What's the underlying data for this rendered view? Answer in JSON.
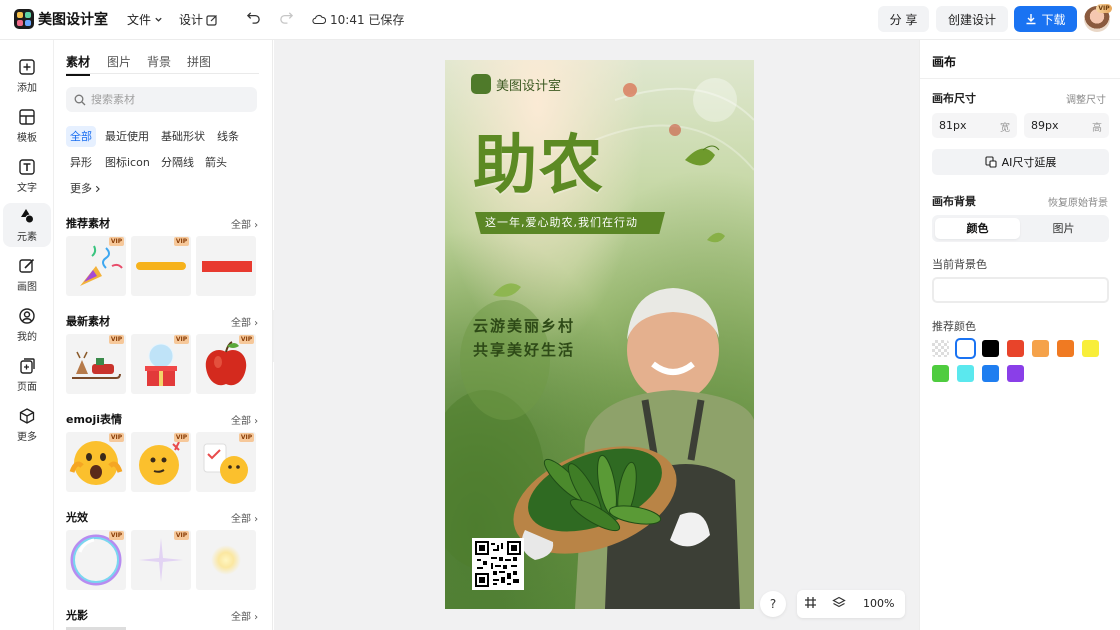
{
  "app": {
    "name": "美图设计室"
  },
  "topbar": {
    "file_menu": "文件",
    "design_menu": "设计",
    "save_status": "10:41 已保存",
    "share_label": "分 享",
    "create_label": "创建设计",
    "download_label": "下载",
    "avatar_badge": "VIP"
  },
  "rail": {
    "items": [
      {
        "label": "添加",
        "icon": "plus-square-icon"
      },
      {
        "label": "模板",
        "icon": "template-icon"
      },
      {
        "label": "文字",
        "icon": "text-icon"
      },
      {
        "label": "元素",
        "icon": "shapes-icon"
      },
      {
        "label": "画图",
        "icon": "draw-icon"
      },
      {
        "label": "我的",
        "icon": "user-icon"
      },
      {
        "label": "页面",
        "icon": "pages-icon"
      },
      {
        "label": "更多",
        "icon": "cube-icon"
      }
    ]
  },
  "panel": {
    "tabs": [
      "素材",
      "图片",
      "背景",
      "拼图"
    ],
    "search_placeholder": "搜索素材",
    "chips": [
      "全部",
      "最近使用",
      "基础形状",
      "线条",
      "异形",
      "图标icon",
      "分隔线",
      "箭头",
      "更多"
    ],
    "more_link": "全部",
    "vip_badge": "VIP",
    "sections": [
      {
        "title": "推荐素材"
      },
      {
        "title": "最新素材"
      },
      {
        "title": "emoji表情"
      },
      {
        "title": "光效"
      },
      {
        "title": "光影"
      }
    ]
  },
  "poster": {
    "brand": "美图设计室",
    "title": "助农",
    "banner": "这一年,爱心助农,我们在行动",
    "slogan_line1": "云游美丽乡村",
    "slogan_line2": "共享美好生活"
  },
  "bottom_tools": {
    "help": "?",
    "zoom": "100%"
  },
  "right_panel": {
    "title": "画布",
    "size_label": "画布尺寸",
    "adjust_link": "调整尺寸",
    "width_value": "81px",
    "width_unit": "宽",
    "height_value": "89px",
    "height_unit": "高",
    "ai_button": "AI尺寸延展",
    "bg_label": "画布背景",
    "restore_link": "恢复原始背景",
    "seg_color": "颜色",
    "seg_image": "图片",
    "current_bg_label": "当前背景色",
    "recommend_label": "推荐颜色",
    "swatches": [
      "transparent",
      "#ffffff",
      "#000000",
      "#e8442a",
      "#f5a24a",
      "#f07a22",
      "#f8ee3a",
      "#4fcc3f",
      "#5be8ee",
      "#1f7ef0",
      "#8a3fe8"
    ],
    "accent_color": "#1a73f2"
  }
}
